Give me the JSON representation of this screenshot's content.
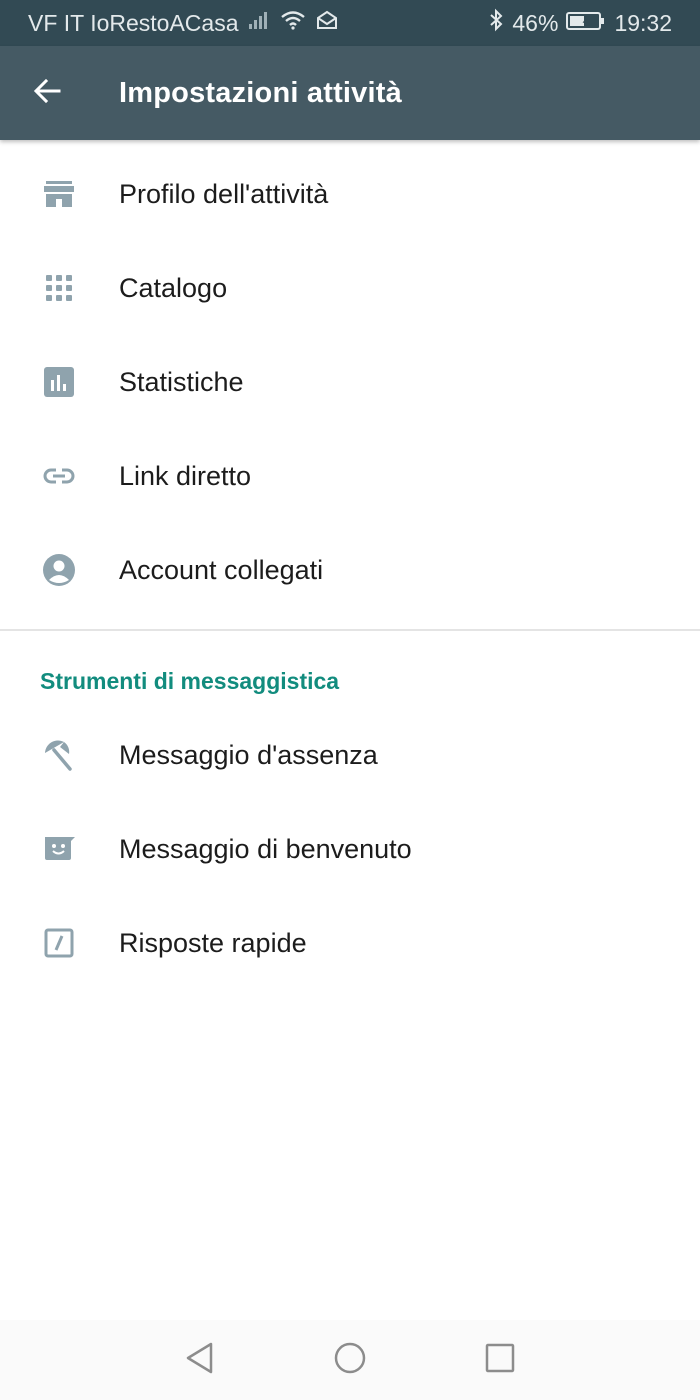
{
  "status_bar": {
    "carrier": "VF IT IoRestoACasa",
    "battery": "46%",
    "time": "19:32"
  },
  "app_bar": {
    "title": "Impostazioni attività"
  },
  "business_items": [
    {
      "label": "Profilo dell'attività",
      "icon": "store-icon"
    },
    {
      "label": "Catalogo",
      "icon": "grid-icon"
    },
    {
      "label": "Statistiche",
      "icon": "bar-chart-icon"
    },
    {
      "label": "Link diretto",
      "icon": "link-icon"
    },
    {
      "label": "Account collegati",
      "icon": "account-circle-icon"
    }
  ],
  "messaging_section": {
    "header": "Strumenti di messaggistica",
    "items": [
      {
        "label": "Messaggio d'assenza",
        "icon": "beach-umbrella-icon"
      },
      {
        "label": "Messaggio di benvenuto",
        "icon": "smiley-message-icon"
      },
      {
        "label": "Risposte rapide",
        "icon": "quick-reply-icon"
      }
    ]
  },
  "colors": {
    "status_bar": "#324a54",
    "app_bar": "#455a64",
    "accent": "#128c7e",
    "icon": "#8fa3ad"
  }
}
